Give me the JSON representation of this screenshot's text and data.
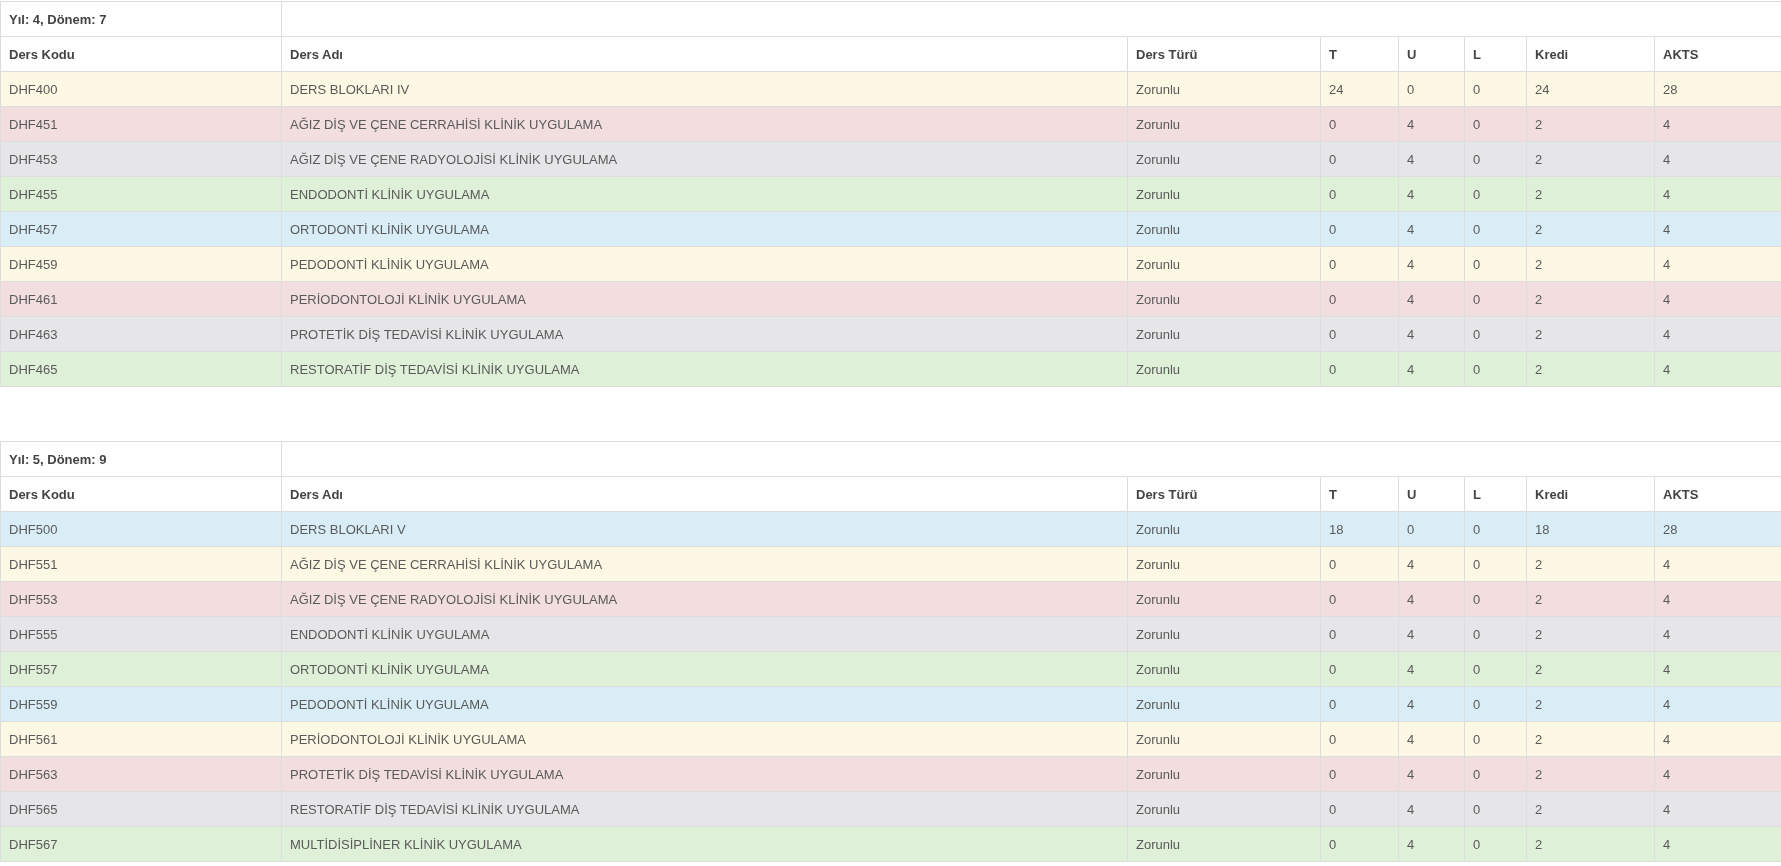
{
  "sections": [
    {
      "title": "Yıl: 4, Dönem: 7",
      "columns": [
        "Ders Kodu",
        "Ders Adı",
        "Ders Türü",
        "T",
        "U",
        "L",
        "Kredi",
        "AKTS"
      ],
      "rows": [
        {
          "code": "DHF400",
          "name": "DERS BLOKLARI IV",
          "type": "Zorunlu",
          "t": "24",
          "u": "0",
          "l": "0",
          "kredi": "24",
          "akts": "28",
          "color": "#fcf8e3"
        },
        {
          "code": "DHF451",
          "name": "AĞIZ DİŞ VE ÇENE CERRAHİSİ KLİNİK UYGULAMA",
          "type": "Zorunlu",
          "t": "0",
          "u": "4",
          "l": "0",
          "kredi": "2",
          "akts": "4",
          "color": "#f2dede"
        },
        {
          "code": "DHF453",
          "name": "AĞIZ DİŞ VE ÇENE RADYOLOJİSİ KLİNİK UYGULAMA",
          "type": "Zorunlu",
          "t": "0",
          "u": "4",
          "l": "0",
          "kredi": "2",
          "akts": "4",
          "color": "#e6e6e8"
        },
        {
          "code": "DHF455",
          "name": "ENDODONTİ KLİNİK UYGULAMA",
          "type": "Zorunlu",
          "t": "0",
          "u": "4",
          "l": "0",
          "kredi": "2",
          "akts": "4",
          "color": "#dff0d8"
        },
        {
          "code": "DHF457",
          "name": "ORTODONTİ KLİNİK UYGULAMA",
          "type": "Zorunlu",
          "t": "0",
          "u": "4",
          "l": "0",
          "kredi": "2",
          "akts": "4",
          "color": "#d9edf7"
        },
        {
          "code": "DHF459",
          "name": "PEDODONTİ KLİNİK UYGULAMA",
          "type": "Zorunlu",
          "t": "0",
          "u": "4",
          "l": "0",
          "kredi": "2",
          "akts": "4",
          "color": "#fcf8e3"
        },
        {
          "code": "DHF461",
          "name": "PERİODONTOLOJİ KLİNİK UYGULAMA",
          "type": "Zorunlu",
          "t": "0",
          "u": "4",
          "l": "0",
          "kredi": "2",
          "akts": "4",
          "color": "#f2dede"
        },
        {
          "code": "DHF463",
          "name": "PROTETİK DİŞ TEDAVİSİ KLİNİK UYGULAMA",
          "type": "Zorunlu",
          "t": "0",
          "u": "4",
          "l": "0",
          "kredi": "2",
          "akts": "4",
          "color": "#e6e6e8"
        },
        {
          "code": "DHF465",
          "name": "RESTORATİF DİŞ TEDAVİSİ KLİNİK UYGULAMA",
          "type": "Zorunlu",
          "t": "0",
          "u": "4",
          "l": "0",
          "kredi": "2",
          "akts": "4",
          "color": "#dff0d8"
        }
      ]
    },
    {
      "title": "Yıl: 5, Dönem: 9",
      "columns": [
        "Ders Kodu",
        "Ders Adı",
        "Ders Türü",
        "T",
        "U",
        "L",
        "Kredi",
        "AKTS"
      ],
      "rows": [
        {
          "code": "DHF500",
          "name": "DERS BLOKLARI V",
          "type": "Zorunlu",
          "t": "18",
          "u": "0",
          "l": "0",
          "kredi": "18",
          "akts": "28",
          "color": "#d9edf7"
        },
        {
          "code": "DHF551",
          "name": "AĞIZ DİŞ VE ÇENE CERRAHİSİ KLİNİK UYGULAMA",
          "type": "Zorunlu",
          "t": "0",
          "u": "4",
          "l": "0",
          "kredi": "2",
          "akts": "4",
          "color": "#fcf8e3"
        },
        {
          "code": "DHF553",
          "name": "AĞIZ DİŞ VE ÇENE RADYOLOJİSİ KLİNİK UYGULAMA",
          "type": "Zorunlu",
          "t": "0",
          "u": "4",
          "l": "0",
          "kredi": "2",
          "akts": "4",
          "color": "#f2dede"
        },
        {
          "code": "DHF555",
          "name": "ENDODONTİ KLİNİK UYGULAMA",
          "type": "Zorunlu",
          "t": "0",
          "u": "4",
          "l": "0",
          "kredi": "2",
          "akts": "4",
          "color": "#e6e6e8"
        },
        {
          "code": "DHF557",
          "name": "ORTODONTİ KLİNİK UYGULAMA",
          "type": "Zorunlu",
          "t": "0",
          "u": "4",
          "l": "0",
          "kredi": "2",
          "akts": "4",
          "color": "#dff0d8"
        },
        {
          "code": "DHF559",
          "name": "PEDODONTİ KLİNİK UYGULAMA",
          "type": "Zorunlu",
          "t": "0",
          "u": "4",
          "l": "0",
          "kredi": "2",
          "akts": "4",
          "color": "#d9edf7"
        },
        {
          "code": "DHF561",
          "name": "PERİODONTOLOJİ KLİNİK UYGULAMA",
          "type": "Zorunlu",
          "t": "0",
          "u": "4",
          "l": "0",
          "kredi": "2",
          "akts": "4",
          "color": "#fcf8e3"
        },
        {
          "code": "DHF563",
          "name": "PROTETİK DİŞ TEDAVİSİ KLİNİK UYGULAMA",
          "type": "Zorunlu",
          "t": "0",
          "u": "4",
          "l": "0",
          "kredi": "2",
          "akts": "4",
          "color": "#f2dede"
        },
        {
          "code": "DHF565",
          "name": "RESTORATİF DİŞ TEDAVİSİ KLİNİK UYGULAMA",
          "type": "Zorunlu",
          "t": "0",
          "u": "4",
          "l": "0",
          "kredi": "2",
          "akts": "4",
          "color": "#e6e6e8"
        },
        {
          "code": "DHF567",
          "name": "MULTİDİSİPLİNER KLİNİK UYGULAMA",
          "type": "Zorunlu",
          "t": "0",
          "u": "4",
          "l": "0",
          "kredi": "2",
          "akts": "4",
          "color": "#dff0d8"
        }
      ]
    }
  ]
}
